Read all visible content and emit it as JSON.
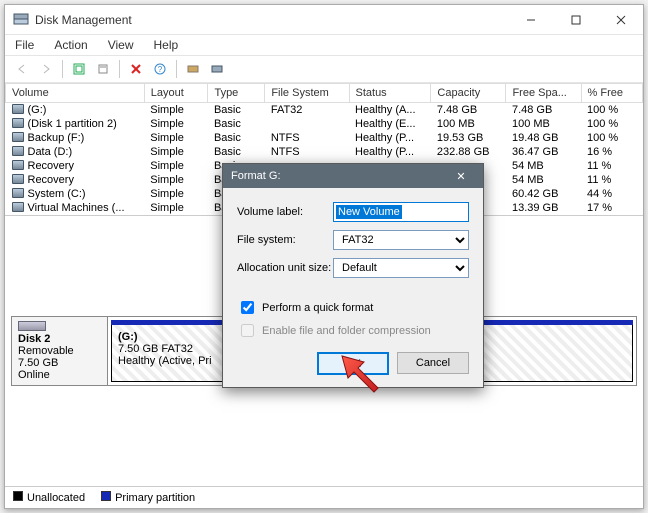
{
  "window": {
    "title": "Disk Management"
  },
  "menu": {
    "file": "File",
    "action": "Action",
    "view": "View",
    "help": "Help"
  },
  "columns": {
    "volume": "Volume",
    "layout": "Layout",
    "type": "Type",
    "fs": "File System",
    "status": "Status",
    "capacity": "Capacity",
    "free": "Free Spa...",
    "pct": "% Free"
  },
  "rows": [
    {
      "volume": "(G:)",
      "layout": "Simple",
      "type": "Basic",
      "fs": "FAT32",
      "status": "Healthy (A...",
      "capacity": "7.48 GB",
      "free": "7.48 GB",
      "pct": "100 %"
    },
    {
      "volume": "(Disk 1 partition 2)",
      "layout": "Simple",
      "type": "Basic",
      "fs": "",
      "status": "Healthy (E...",
      "capacity": "100 MB",
      "free": "100 MB",
      "pct": "100 %"
    },
    {
      "volume": "Backup (F:)",
      "layout": "Simple",
      "type": "Basic",
      "fs": "NTFS",
      "status": "Healthy (P...",
      "capacity": "19.53 GB",
      "free": "19.48 GB",
      "pct": "100 %"
    },
    {
      "volume": "Data (D:)",
      "layout": "Simple",
      "type": "Basic",
      "fs": "NTFS",
      "status": "Healthy (P...",
      "capacity": "232.88 GB",
      "free": "36.47 GB",
      "pct": "16 %"
    },
    {
      "volume": "Recovery",
      "layout": "Simple",
      "type": "Basic",
      "fs": "",
      "status": "",
      "capacity": "",
      "free": "54 MB",
      "pct": "11 %"
    },
    {
      "volume": "Recovery",
      "layout": "Simple",
      "type": "Basic",
      "fs": "",
      "status": "",
      "capacity": "",
      "free": "54 MB",
      "pct": "11 %"
    },
    {
      "volume": "System (C:)",
      "layout": "Simple",
      "type": "Basic",
      "fs": "",
      "status": "",
      "capacity": "",
      "free": "60.42 GB",
      "pct": "44 %"
    },
    {
      "volume": "Virtual Machines (...",
      "layout": "Simple",
      "type": "Basic",
      "fs": "",
      "status": "",
      "capacity": "",
      "free": "13.39 GB",
      "pct": "17 %"
    }
  ],
  "disk": {
    "name": "Disk 2",
    "kind": "Removable",
    "size": "7.50 GB",
    "state": "Online",
    "part_label": "(G:)",
    "part_size": "7.50 GB FAT32",
    "part_status": "Healthy (Active, Pri"
  },
  "legend": {
    "unalloc": "Unallocated",
    "primary": "Primary partition"
  },
  "dialog": {
    "title": "Format G:",
    "label_volume": "Volume label:",
    "label_fs": "File system:",
    "label_au": "Allocation unit size:",
    "value_volume": "New Volume",
    "value_fs": "FAT32",
    "value_au": "Default",
    "chk_quick": "Perform a quick format",
    "chk_compress": "Enable file and folder compression",
    "btn_ok": "OK",
    "btn_cancel": "Cancel"
  }
}
